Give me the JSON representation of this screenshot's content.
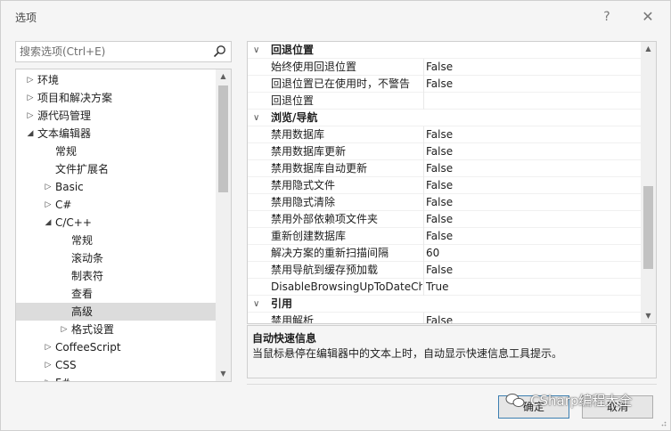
{
  "window": {
    "title": "选项",
    "help": "?",
    "close": "✕"
  },
  "search": {
    "placeholder": "搜索选项(Ctrl+E)"
  },
  "tree": {
    "items": [
      {
        "label": "环境",
        "arrow": "▷"
      },
      {
        "label": "项目和解决方案",
        "arrow": "▷"
      },
      {
        "label": "源代码管理",
        "arrow": "▷"
      },
      {
        "label": "文本编辑器",
        "arrow": "◢"
      },
      {
        "label": "常规",
        "arrow": ""
      },
      {
        "label": "文件扩展名",
        "arrow": ""
      },
      {
        "label": "Basic",
        "arrow": "▷"
      },
      {
        "label": "C#",
        "arrow": "▷"
      },
      {
        "label": "C/C++",
        "arrow": "◢"
      },
      {
        "label": "常规",
        "arrow": ""
      },
      {
        "label": "滚动条",
        "arrow": ""
      },
      {
        "label": "制表符",
        "arrow": ""
      },
      {
        "label": "查看",
        "arrow": ""
      },
      {
        "label": "高级",
        "arrow": ""
      },
      {
        "label": "格式设置",
        "arrow": "▷"
      },
      {
        "label": "CoffeeScript",
        "arrow": "▷"
      },
      {
        "label": "CSS",
        "arrow": "▷"
      },
      {
        "label": "F#",
        "arrow": "▷"
      }
    ]
  },
  "grid": {
    "rows": [
      {
        "type": "cat",
        "label": "回退位置",
        "arrow": "∨"
      },
      {
        "type": "prop",
        "name": "始终使用回退位置",
        "value": "False"
      },
      {
        "type": "prop",
        "name": "回退位置已在使用时，不警告",
        "value": "False"
      },
      {
        "type": "prop",
        "name": "回退位置",
        "value": ""
      },
      {
        "type": "cat",
        "label": "浏览/导航",
        "arrow": "∨"
      },
      {
        "type": "prop",
        "name": "禁用数据库",
        "value": "False"
      },
      {
        "type": "prop",
        "name": "禁用数据库更新",
        "value": "False"
      },
      {
        "type": "prop",
        "name": "禁用数据库自动更新",
        "value": "False"
      },
      {
        "type": "prop",
        "name": "禁用隐式文件",
        "value": "False"
      },
      {
        "type": "prop",
        "name": "禁用隐式清除",
        "value": "False"
      },
      {
        "type": "prop",
        "name": "禁用外部依赖项文件夹",
        "value": "False"
      },
      {
        "type": "prop",
        "name": "重新创建数据库",
        "value": "False"
      },
      {
        "type": "prop",
        "name": "解决方案的重新扫描间隔",
        "value": "60"
      },
      {
        "type": "prop",
        "name": "禁用导航到缓存预加载",
        "value": "False"
      },
      {
        "type": "prop",
        "name": "DisableBrowsingUpToDateCh",
        "value": "True"
      },
      {
        "type": "cat",
        "label": "引用",
        "arrow": "∨"
      },
      {
        "type": "prop",
        "name": "禁用解析",
        "value": "False"
      }
    ]
  },
  "description": {
    "title": "自动快速信息",
    "text": "当鼠标悬停在编辑器中的文本上时，自动显示快速信息工具提示。"
  },
  "buttons": {
    "ok": "确定",
    "cancel": "取消"
  },
  "watermark": {
    "text": "CSharp编程大全"
  },
  "scroll": {
    "tree_thumb_fraction": 0.38,
    "grid_thumb_fraction": 0.33
  }
}
